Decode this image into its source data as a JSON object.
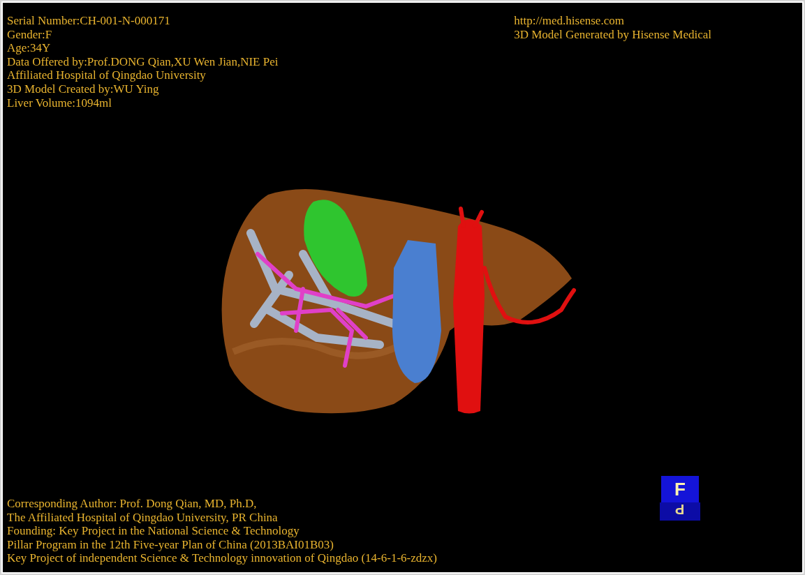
{
  "info_left": [
    "Serial Number:CH-001-N-000171",
    "Gender:F",
    "Age:34Y",
    "Data Offered by:Prof.DONG Qian,XU Wen Jian,NIE Pei",
    "Affiliated Hospital of Qingdao University",
    "3D Model Created by:WU Ying",
    "Liver Volume:1094ml"
  ],
  "info_right": [
    "http://med.hisense.com",
    "3D Model Generated by Hisense Medical"
  ],
  "credits": [
    "Corresponding Author: Prof. Dong Qian, MD, Ph.D,",
    "The Affiliated Hospital of Qingdao University, PR China",
    "Founding: Key Project in the National Science & Technology",
    "Pillar Program in the 12th Five-year Plan of China (2013BAI01B03)",
    "Key Project of independent Science & Technology innovation of Qingdao (14-6-1-6-zdzx)"
  ],
  "orientation_cube": {
    "front": "F",
    "bottom": "P"
  }
}
